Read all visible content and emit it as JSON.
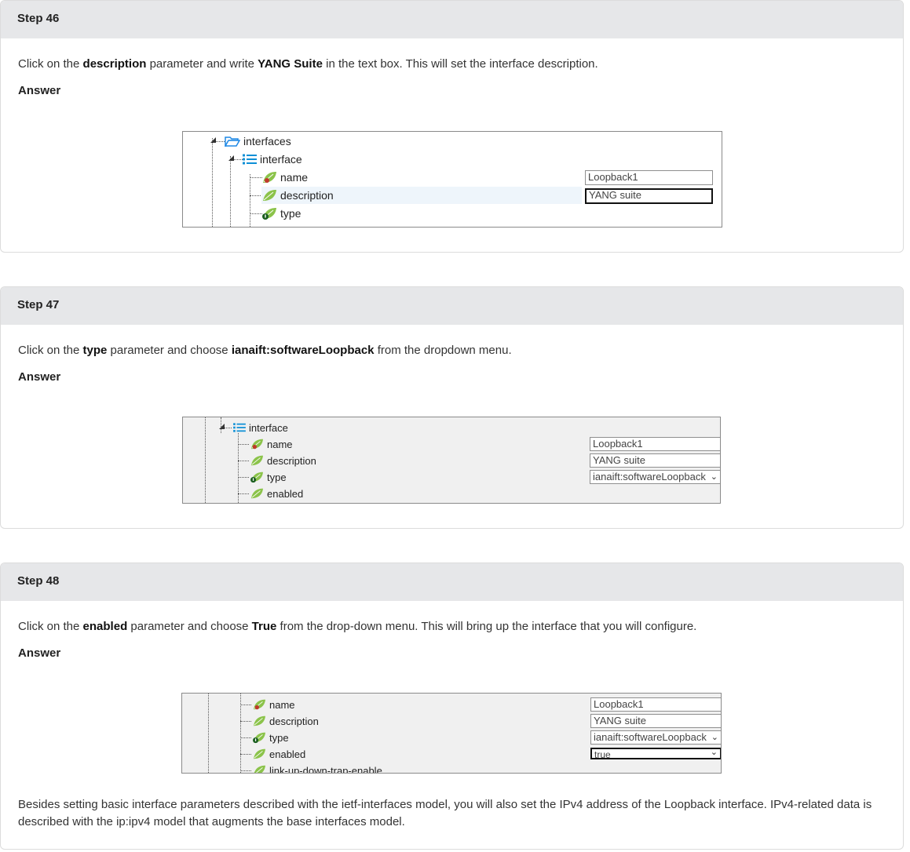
{
  "steps": [
    {
      "title": "Step 46",
      "instruction": {
        "t1": "Click on the ",
        "b1": "description",
        "t2": " parameter and write ",
        "b2": "YANG Suite",
        "t3": " in the text box. This will set the interface description."
      },
      "answer_label": "Answer",
      "tree": {
        "interfaces": "interfaces",
        "interface": "interface",
        "name": "name",
        "description": "description",
        "type": "type"
      },
      "fields": {
        "name": "Loopback1",
        "description": "YANG suite"
      }
    },
    {
      "title": "Step 47",
      "instruction": {
        "t1": "Click on the ",
        "b1": "type",
        "t2": " parameter and choose ",
        "b2": "ianaift:softwareLoopback",
        "t3": " from the dropdown menu."
      },
      "answer_label": "Answer",
      "tree": {
        "interface": "interface",
        "name": "name",
        "description": "description",
        "type": "type",
        "enabled": "enabled"
      },
      "fields": {
        "name": "Loopback1",
        "description": "YANG suite",
        "type": "ianaift:softwareLoopback"
      }
    },
    {
      "title": "Step 48",
      "instruction": {
        "t1": "Click on the ",
        "b1": "enabled",
        "t2": " parameter and choose ",
        "b2": "True",
        "t3": " from the drop-down menu. This will bring up the interface that you will configure."
      },
      "answer_label": "Answer",
      "tree": {
        "name": "name",
        "description": "description",
        "type": "type",
        "enabled": "enabled",
        "link": "link-up-down-trap-enable"
      },
      "fields": {
        "name": "Loopback1",
        "description": "YANG suite",
        "type": "ianaift:softwareLoopback",
        "enabled": "true"
      },
      "paragraph": "Besides setting basic interface parameters described with the ietf-interfaces model, you will also set the IPv4 address of the Loopback interface. IPv4-related data is described with the ip:ipv4 model that augments the base interfaces model."
    }
  ],
  "icons": {
    "folder": "folder-open-icon",
    "list": "list-icon",
    "leaf_key": "leaf-key-icon",
    "leaf": "leaf-icon",
    "leaf_info": "leaf-info-icon",
    "expanded": "expanded-triangle-icon",
    "dropdown": "chevron-down-icon"
  },
  "colors": {
    "header_bg": "#e6e7e9",
    "leaf_green": "#8bc34a",
    "key_red": "#c0392b",
    "folder_blue": "#1e88e5",
    "list_blue": "#0d8fd6"
  }
}
